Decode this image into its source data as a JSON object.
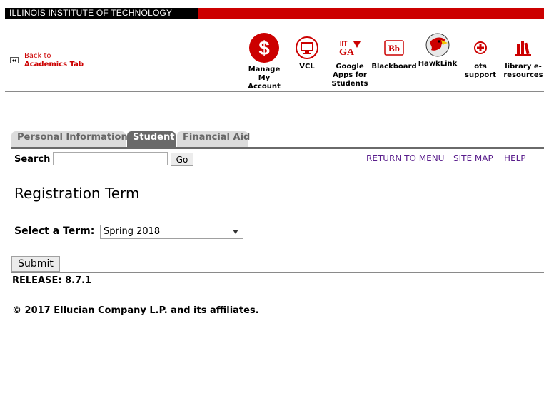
{
  "header": {
    "banner_title": "ILLINOIS INSTITUTE OF TECHNOLOGY",
    "back_link": {
      "line1": "Back to",
      "line2": "Academics Tab"
    }
  },
  "apps": [
    {
      "label": "Manage My Account",
      "icon": "dollar-icon"
    },
    {
      "label": "VCL",
      "icon": "monitor-icon"
    },
    {
      "label": "Google Apps for Students",
      "icon": "google-apps-icon"
    },
    {
      "label": "Blackboard",
      "icon": "blackboard-icon"
    },
    {
      "label": "HawkLink",
      "icon": "hawk-icon"
    },
    {
      "label": "ots support",
      "icon": "plus-icon"
    },
    {
      "label": "library e-resources",
      "icon": "library-icon"
    }
  ],
  "tabs": [
    {
      "label": "Personal Information",
      "active": false
    },
    {
      "label": "Student",
      "active": true
    },
    {
      "label": "Financial Aid",
      "active": false
    }
  ],
  "search": {
    "label": "Search",
    "value": "",
    "go_label": "Go"
  },
  "top_links": [
    "RETURN TO MENU",
    "SITE MAP",
    "HELP"
  ],
  "page_title": "Registration Term",
  "term": {
    "label": "Select a Term:",
    "selected": "Spring 2018"
  },
  "submit_label": "Submit",
  "release": "RELEASE: 8.7.1",
  "copyright": "© 2017 Ellucian Company L.P. and its affiliates.",
  "colors": {
    "brand_red": "#cc0000",
    "link_purple": "#5a1e8c",
    "tab_active": "#6a6a6a"
  }
}
